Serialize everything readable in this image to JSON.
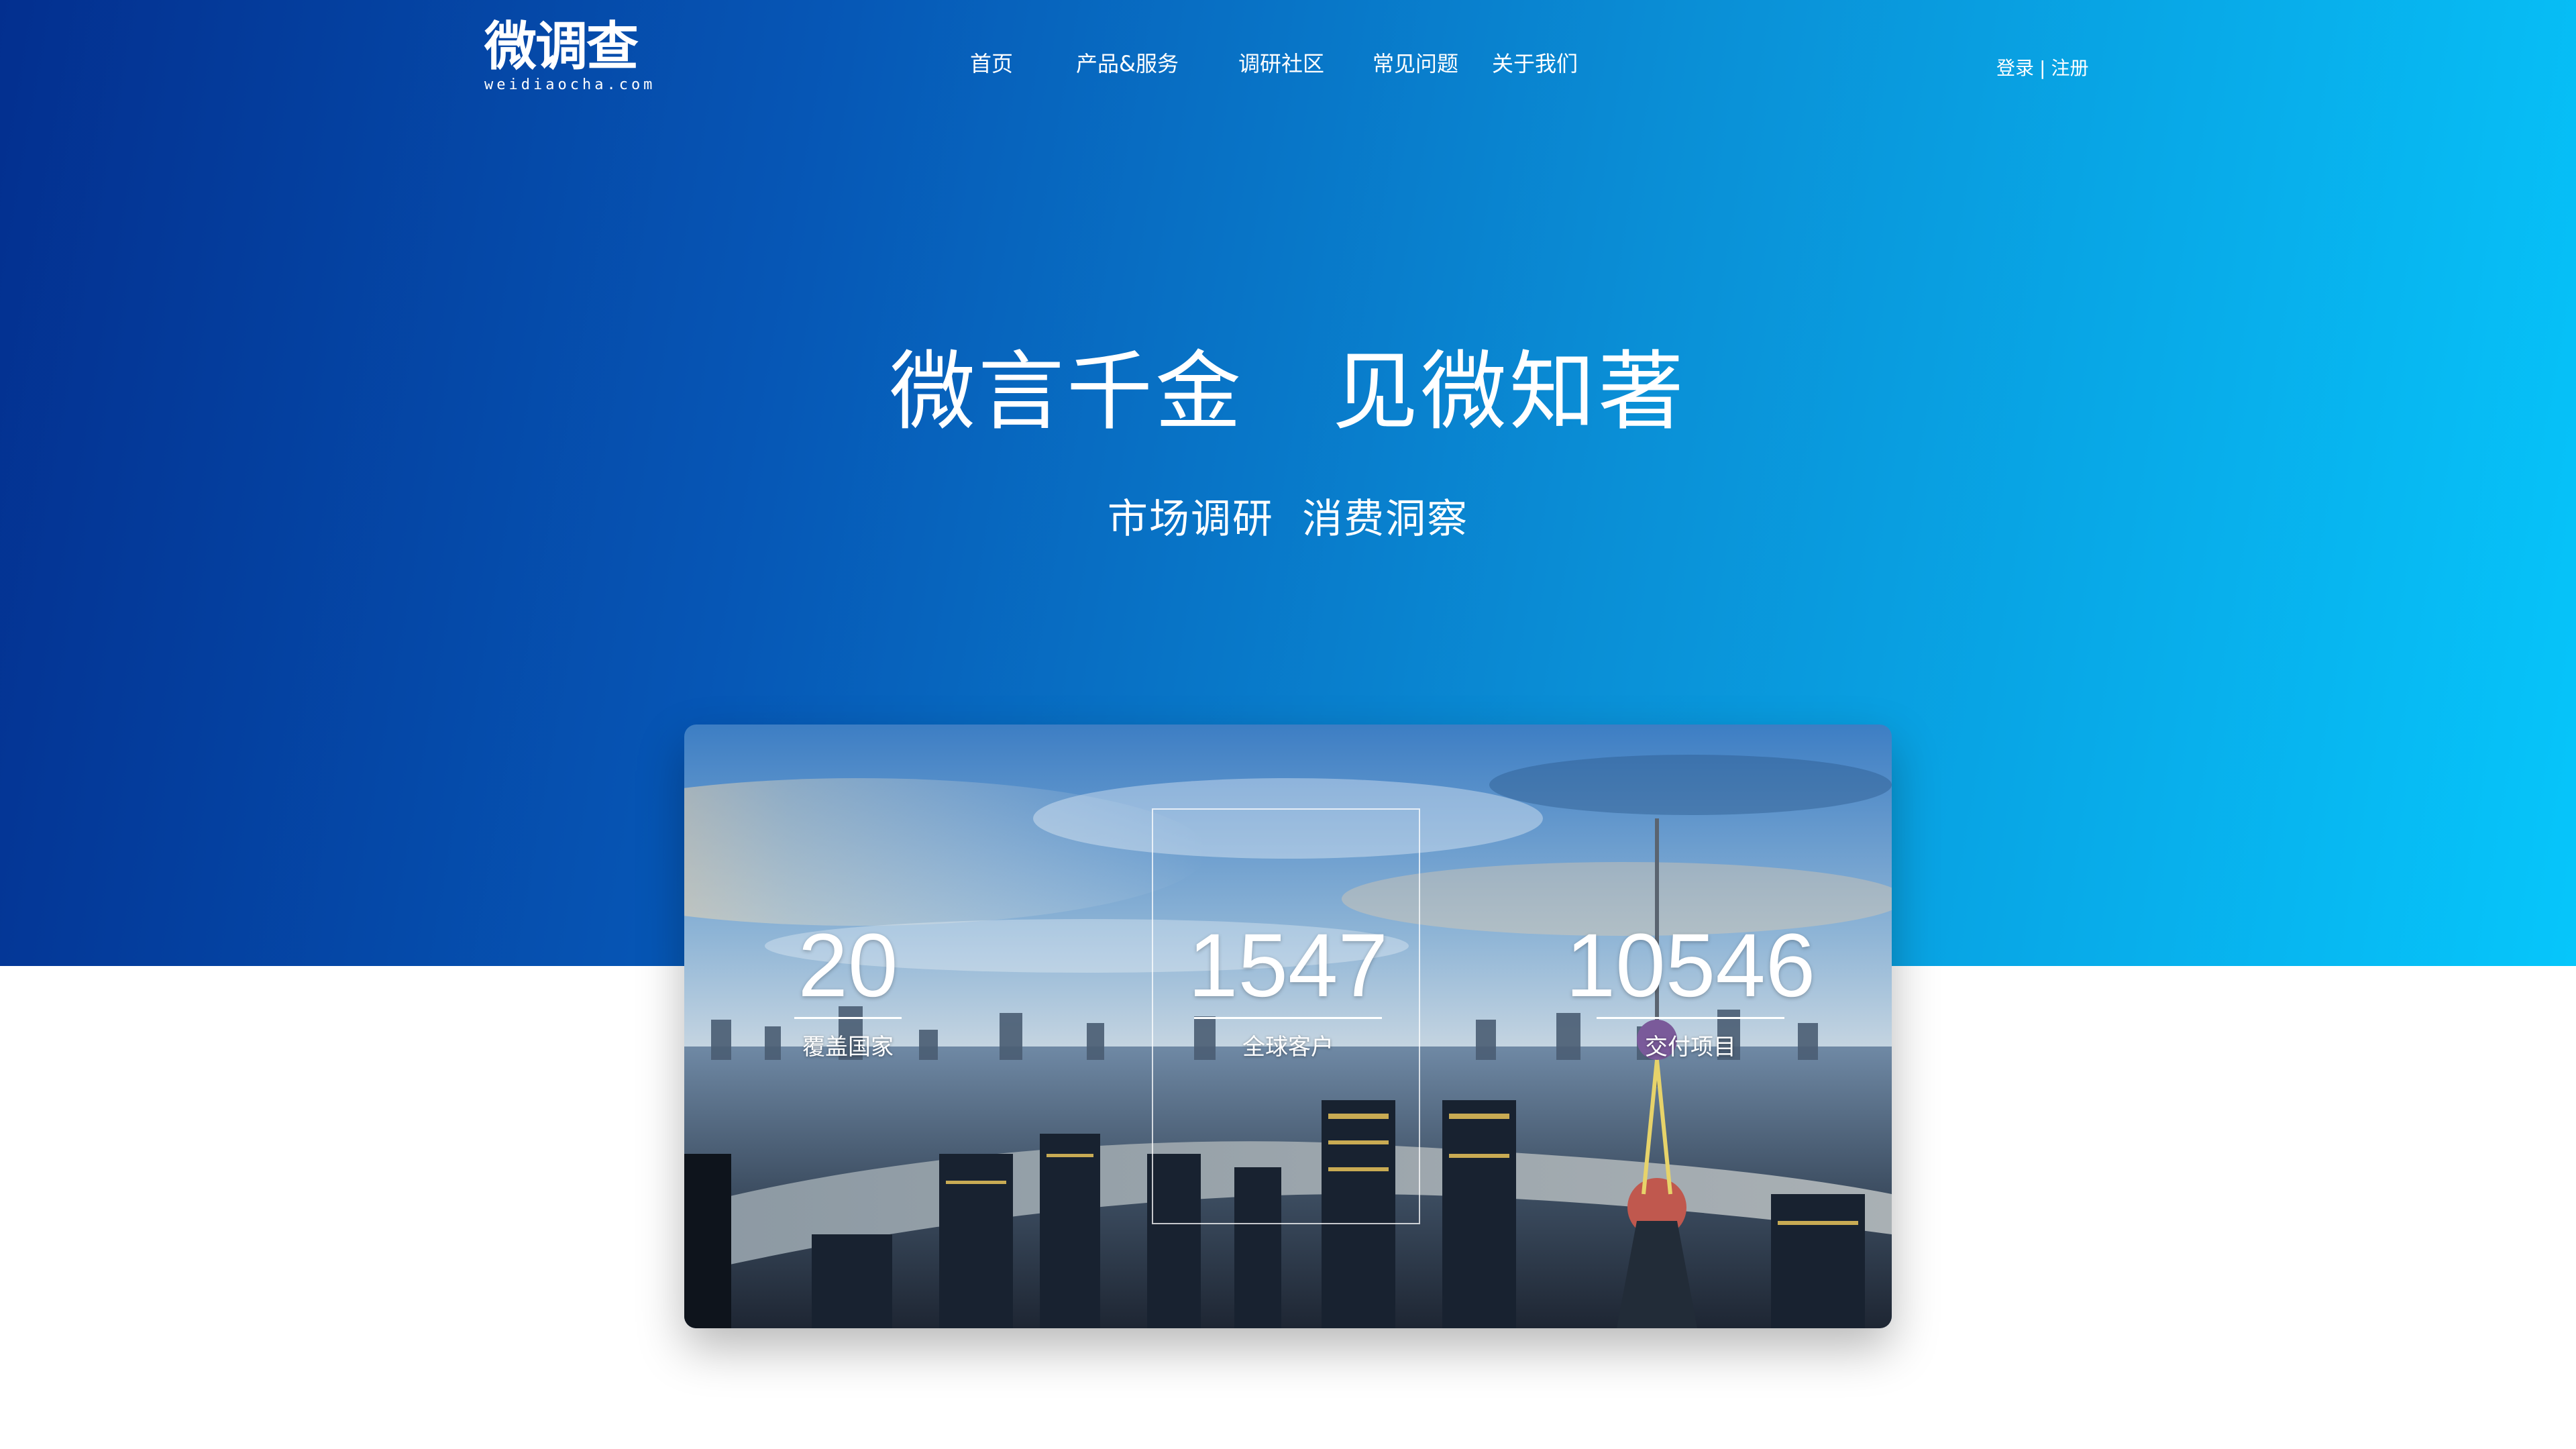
{
  "brand": {
    "name": "微调查",
    "domain": "weidiaocha.com"
  },
  "nav": {
    "items": [
      "首页",
      "产品&服务",
      "调研社区",
      "常见问题",
      "关于我们"
    ]
  },
  "auth": {
    "login": "登录",
    "separator": "|",
    "register": "注册"
  },
  "hero": {
    "title": "微言千金　见微知著",
    "subtitle": "市场调研  消费洞察"
  },
  "stats": [
    {
      "value": "20",
      "label": "覆盖国家"
    },
    {
      "value": "1547",
      "label": "全球客户"
    },
    {
      "value": "10546",
      "label": "交付项目"
    }
  ],
  "colors": {
    "hero_start": "#032f8f",
    "hero_end": "#06c6fb"
  },
  "icons": {
    "hero_image": "city-skyline-image"
  }
}
